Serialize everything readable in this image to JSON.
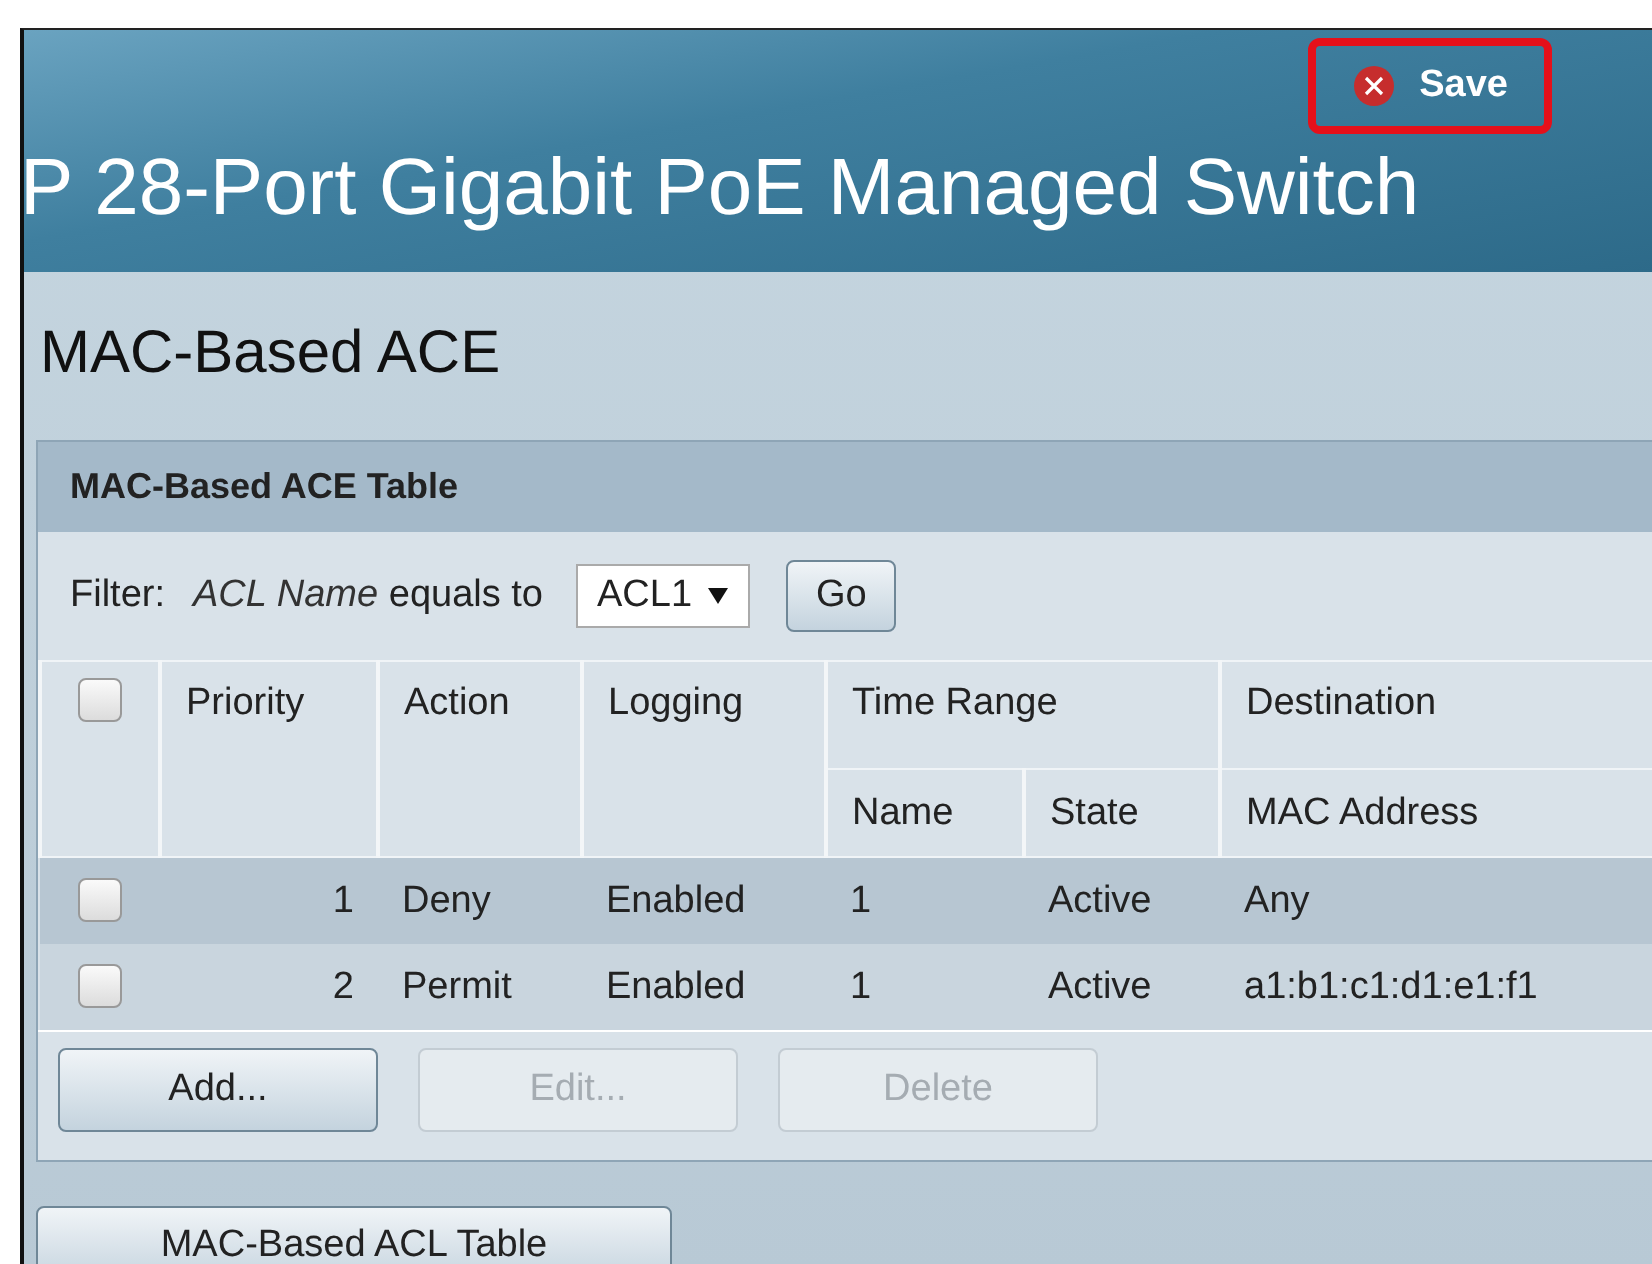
{
  "header": {
    "title": "P 28-Port Gigabit PoE Managed Switch",
    "save_button": {
      "label": "Save",
      "highlighted": true
    }
  },
  "page_title": "MAC-Based ACE",
  "table_panel": {
    "title": "MAC-Based ACE Table",
    "filter": {
      "label": "Filter:",
      "field": "ACL Name",
      "operator": "equals to",
      "value": "ACL1",
      "go_button": "Go"
    },
    "header_rows": [
      [
        {
          "label": "Priority",
          "rowspan": 2
        },
        {
          "label": "Action",
          "rowspan": 2
        },
        {
          "label": "Logging",
          "rowspan": 2
        },
        {
          "label": "Time Range",
          "colspan": 2
        },
        {
          "label": "Destination"
        }
      ],
      [
        {
          "label": "Name"
        },
        {
          "label": "State"
        },
        {
          "label": "MAC Address"
        }
      ]
    ],
    "select_all": {
      "checked": false
    },
    "rows": [
      {
        "checked": false,
        "cells": [
          "1",
          "Deny",
          "Enabled",
          "1",
          "Active",
          "Any"
        ]
      },
      {
        "checked": false,
        "cells": [
          "2",
          "Permit",
          "Enabled",
          "1",
          "Active",
          "a1:b1:c1:d1:e1:f1"
        ]
      }
    ],
    "buttons": [
      {
        "label": "Add...",
        "disabled": false
      },
      {
        "label": "Edit...",
        "disabled": true
      },
      {
        "label": "Delete",
        "disabled": true
      }
    ]
  },
  "footer_button": "MAC-Based ACL Table"
}
